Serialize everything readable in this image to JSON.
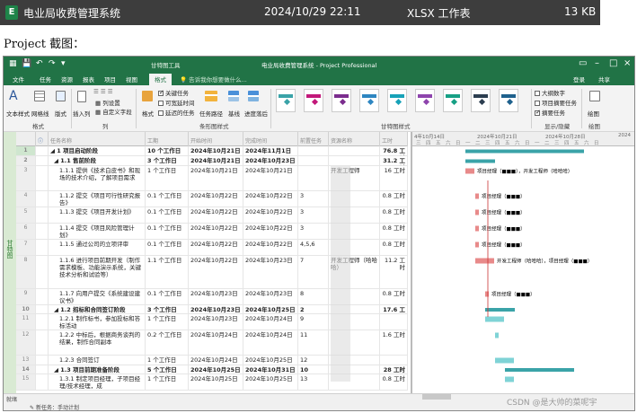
{
  "file": {
    "name": "电业局收费管理系统",
    "date": "2024/10/29 22:11",
    "type": "XLSX 工作表",
    "size": "13 KB"
  },
  "caption": "Project 截图：",
  "window": {
    "title": "电业局收费管理系统 - Project Professional",
    "context_tab": "甘特图工具",
    "tabs": [
      "文件",
      "任务",
      "资源",
      "报表",
      "项目",
      "视图",
      "格式"
    ],
    "tell_me": "告诉我你想要做什么...",
    "login": "登录",
    "share": "共享"
  },
  "ribbon": {
    "text_styles": "文本样式",
    "gridlines": "网格线",
    "layout": "版式",
    "insert_column": "插入列",
    "column_settings": "列设置",
    "custom_fields": "自定义字段",
    "format": "格式",
    "critical_tasks": "关键任务",
    "slack": "可宽延时间",
    "late_tasks": "延迟的任务",
    "task_path": "任务路径",
    "baseline": "基线",
    "slippage": "进度落后",
    "outline_number": "大纲数字",
    "project_summary": "项目摘要任务",
    "summary_tasks": "摘要任务",
    "drawing": "绘图",
    "groups": [
      "格式",
      "列",
      "条形图样式",
      "甘特图样式",
      "显示/隐藏",
      "绘图"
    ]
  },
  "sidebar_label": "甘特图",
  "columns": [
    "任务名称",
    "工期",
    "开始时间",
    "完成时间",
    "前置任务",
    "资源名称",
    "工时"
  ],
  "rows": [
    {
      "id": "1",
      "name": "◢ 1 项目启动阶段",
      "dur": "10 个工作日",
      "start": "2024年10月21日",
      "finish": "2024年11月1日",
      "pred": "",
      "res": "",
      "work": "76.8 工时",
      "summary": true,
      "h": 11
    },
    {
      "id": "2",
      "name": "◢ 1.1 售前阶段",
      "dur": "3 个工作日",
      "start": "2024年10月21日",
      "finish": "2024年10月23日",
      "pred": "",
      "res": "",
      "work": "31.2 工时",
      "summary": true,
      "h": 11
    },
    {
      "id": "3",
      "name": "1.1.1 提供《技术白皮书》和现场的技术介绍，了解项目需求",
      "dur": "1 个工作日",
      "start": "2024年10月21日",
      "finish": "2024年10月21日",
      "pred": "",
      "res": "开发工程师",
      "work": "16 工时",
      "summary": false,
      "h": 28
    },
    {
      "id": "4",
      "name": "1.1.2 提交《项目可行性研究报告》",
      "dur": "0.1 个工作日",
      "start": "2024年10月22日",
      "finish": "2024年10月22日",
      "pred": "3",
      "res": "",
      "work": "0.8 工时",
      "summary": false,
      "h": 18
    },
    {
      "id": "5",
      "name": "1.1.3 提交《项目开发计划》",
      "dur": "0.1 个工作日",
      "start": "2024年10月22日",
      "finish": "2024年10月22日",
      "pred": "3",
      "res": "",
      "work": "0.8 工时",
      "summary": false,
      "h": 18
    },
    {
      "id": "6",
      "name": "1.1.4 提交《项目风险管理计划》",
      "dur": "0.1 个工作日",
      "start": "2024年10月22日",
      "finish": "2024年10月22日",
      "pred": "3",
      "res": "",
      "work": "0.8 工时",
      "summary": false,
      "h": 18
    },
    {
      "id": "7",
      "name": "1.1.5 通过公司的立项评审",
      "dur": "0.1 个工作日",
      "start": "2024年10月22日",
      "finish": "2024年10月22日",
      "pred": "4,5,6",
      "res": "",
      "work": "0.8 工时",
      "summary": false,
      "h": 18
    },
    {
      "id": "8",
      "name": "1.1.6 进行项目前期开发（制作需求模板、功能演示系统，关键技术分析和试验等）",
      "dur": "1.1 个工作日",
      "start": "2024年10月22日",
      "finish": "2024年10月23日",
      "pred": "7",
      "res": "开发工程师（哈哈哈）",
      "work": "11.2 工时",
      "summary": false,
      "h": 37
    },
    {
      "id": "9",
      "name": "1.1.7 向用户提交《系统建设建议书》",
      "dur": "0.1 个工作日",
      "start": "2024年10月23日",
      "finish": "2024年10月23日",
      "pred": "8",
      "res": "",
      "work": "0.8 工时",
      "summary": false,
      "h": 18
    },
    {
      "id": "10",
      "name": "◢ 1.2 招标和合同签订阶段",
      "dur": "3 个工作日",
      "start": "2024年10月23日",
      "finish": "2024年10月25日",
      "pred": "2",
      "res": "",
      "work": "17.6 工时",
      "summary": true,
      "h": 10
    },
    {
      "id": "11",
      "name": "1.2.1 制作标书，参加投标和答标活动",
      "dur": "1 个工作日",
      "start": "2024年10月23日",
      "finish": "2024年10月24日",
      "pred": "9",
      "res": "",
      "work": "",
      "summary": false,
      "h": 18
    },
    {
      "id": "12",
      "name": "1.2.2 中标后，根据商务谈判的结果，制作合同副本",
      "dur": "0.2 个工作日",
      "start": "2024年10月24日",
      "finish": "2024年10月24日",
      "pred": "11",
      "res": "",
      "work": "1.6 工时",
      "summary": false,
      "h": 28
    },
    {
      "id": "13",
      "name": "1.2.3 合同签订",
      "dur": "1 个工作日",
      "start": "2024年10月24日",
      "finish": "2024年10月25日",
      "pred": "12",
      "res": "",
      "work": "",
      "summary": false,
      "h": 11
    },
    {
      "id": "14",
      "name": "◢ 1.3 项目前期准备阶段",
      "dur": "5 个工作日",
      "start": "2024年10月25日",
      "finish": "2024年10月31日",
      "pred": "10",
      "res": "",
      "work": "28 工时",
      "summary": true,
      "h": 10
    },
    {
      "id": "15",
      "name": "1.3.1 制定项目经理，子项目经理/技术经理，成",
      "dur": "1 个工作日",
      "start": "2024年10月25日",
      "finish": "2024年10月25日",
      "pred": "13",
      "res": "",
      "work": "0.8 工时",
      "summary": false,
      "h": 18
    }
  ],
  "gantt": {
    "weeks": [
      "4年10月14日",
      "2024年10月21日",
      "2024年10月28日",
      "2024"
    ],
    "days": [
      "三",
      "四",
      "五",
      "六",
      "日",
      "一",
      "二",
      "三",
      "四",
      "五",
      "六",
      "日",
      "一",
      "二",
      "三",
      "四",
      "五",
      "六",
      "日"
    ],
    "labels": [
      {
        "text": "项目经理（■■■），开发工程师（哈哈哈）"
      },
      {
        "text": "项目经理（■■■）"
      },
      {
        "text": "项目经理（■■■）"
      },
      {
        "text": "项目经理（■■■）"
      },
      {
        "text": "项目经理（■■■）"
      },
      {
        "text": "开发工程师（哈哈哈），项目经理（■■■）"
      },
      {
        "text": "项目经理（■■■）"
      }
    ]
  },
  "status": {
    "ready": "就绪",
    "new_tasks": "新任务：手动计划"
  },
  "watermark": "CSDN @是大帅的菜呢宇",
  "colors": {
    "accent": "#217346",
    "summary_bar": "#3aa3a8",
    "task_bar": "#e88a8a",
    "critical_line": "#cc3333"
  }
}
